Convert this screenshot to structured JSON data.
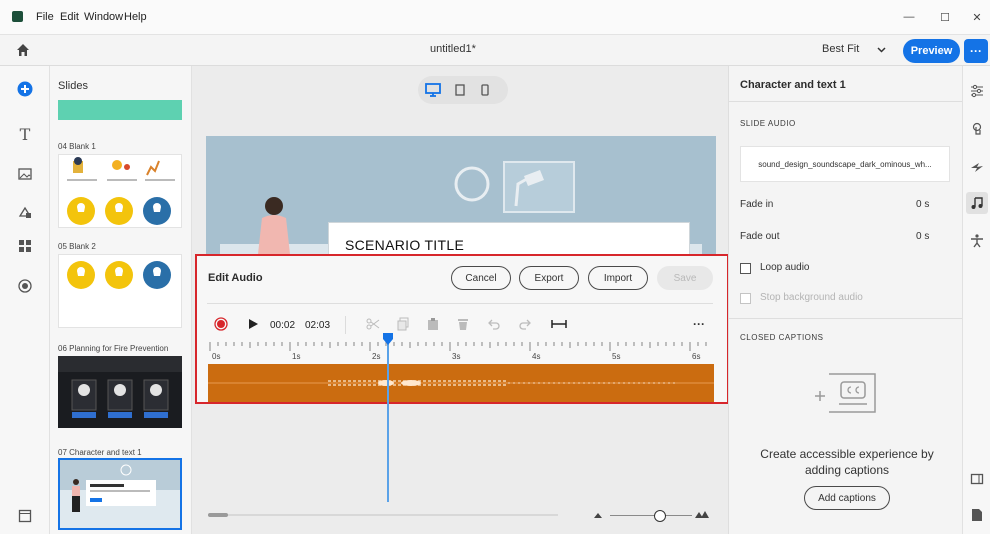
{
  "menu": {
    "file": "File",
    "edit": "Edit",
    "window": "Window",
    "help": "Help"
  },
  "window_controls": {
    "minimize": "—",
    "maximize": "☐",
    "close": "✕"
  },
  "toolbar": {
    "doc_title": "untitled1*",
    "zoom_label": "Best Fit",
    "preview": "Preview",
    "more": "···"
  },
  "slides_panel": {
    "title": "Slides",
    "slides": [
      {
        "label": "04 Blank 1"
      },
      {
        "label": "05 Blank 2"
      },
      {
        "label": "06 Planning for Fire Prevention"
      },
      {
        "label": "07 Character and text 1"
      }
    ]
  },
  "canvas": {
    "scenario_title": "SCENARIO TITLE"
  },
  "edit_audio": {
    "title": "Edit Audio",
    "cancel": "Cancel",
    "export": "Export",
    "import": "Import",
    "save": "Save",
    "time_current": "00:02",
    "time_total": "02:03",
    "more": "···",
    "ruler_labels": [
      "0s",
      "1s",
      "2s",
      "3s",
      "4s",
      "5s",
      "6s"
    ],
    "playhead_seconds": 2.3
  },
  "properties": {
    "title": "Character and text 1",
    "slide_audio_header": "SLIDE AUDIO",
    "audio_file": "sound_design_soundscape_dark_ominous_wh...",
    "fade_in_label": "Fade in",
    "fade_in_value": "0 s",
    "fade_out_label": "Fade out",
    "fade_out_value": "0 s",
    "loop_audio": "Loop audio",
    "stop_background_audio": "Stop background audio",
    "closed_captions_header": "CLOSED CAPTIONS",
    "cc_empty_text": "Create accessible experience by adding captions",
    "add_captions": "Add captions"
  },
  "colors": {
    "accent": "#1473e6",
    "waveform": "#cb6c10",
    "highlight_border": "#d7262b",
    "playhead": "#5aa2e8"
  }
}
